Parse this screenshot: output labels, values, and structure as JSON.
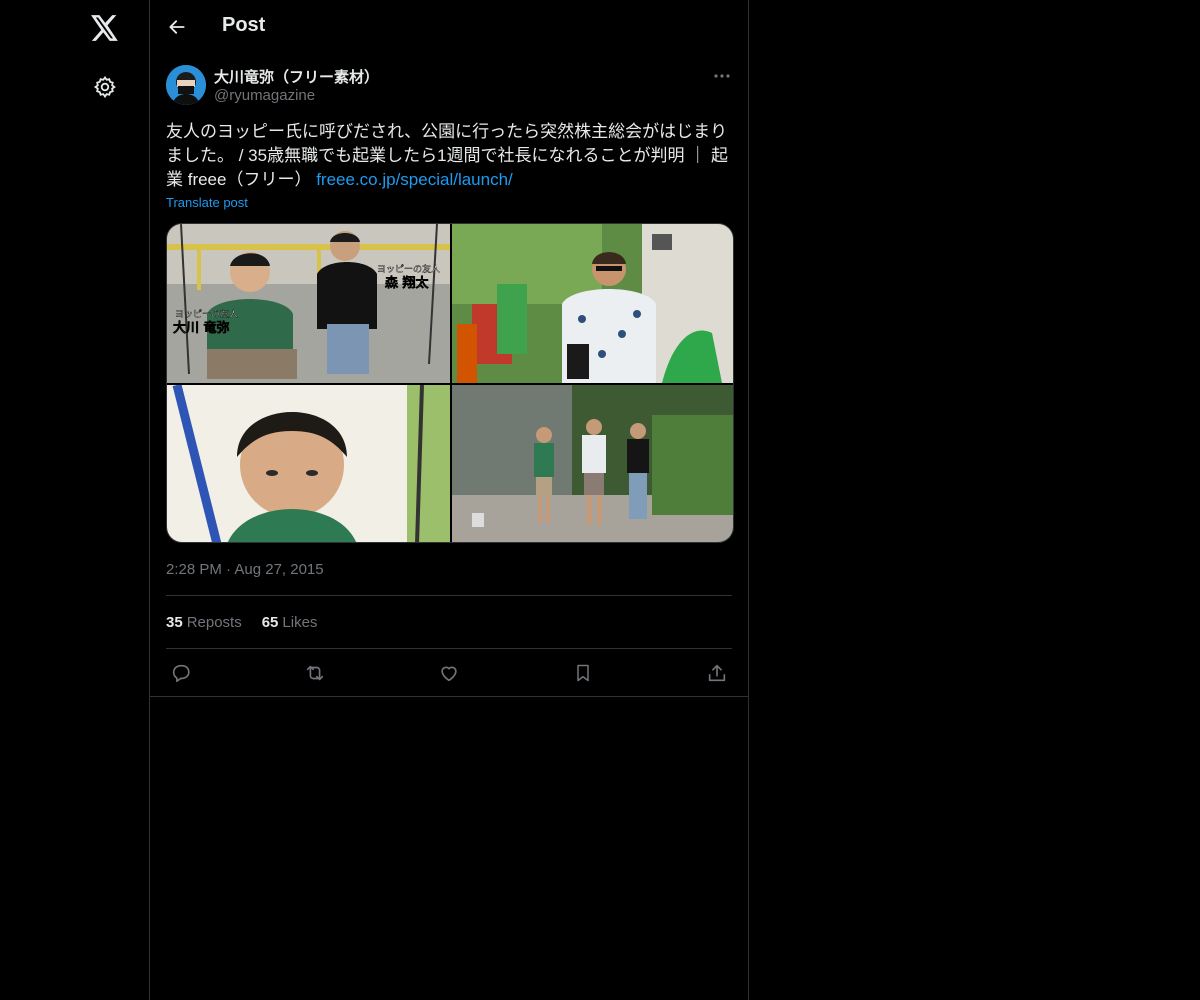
{
  "nav": {
    "logo_icon": "x-logo-icon",
    "settings_icon": "gear-icon"
  },
  "header": {
    "title": "Post",
    "back_icon": "back-arrow-icon"
  },
  "post": {
    "author_name": "大川竜弥（フリー素材）",
    "author_handle": "@ryumagazine",
    "text": "友人のヨッピー氏に呼びだされ、公園に行ったら突然株主総会がはじまりました。 / 35歳無職でも起業したら1週間で社長になれることが判明 ｜ 起業 freee（フリー） ",
    "link_text": "freee.co.jp/special/launch/",
    "translate_label": "Translate post",
    "captions": {
      "img1_a_small": "ヨッピーの友人",
      "img1_a_big": "大川 竜弥",
      "img1_b_small": "ヨッピーの友人",
      "img1_b_big": "森 翔太"
    },
    "timestamp": "2:28 PM · Aug 27, 2015",
    "reposts_count": "35",
    "reposts_label": "Reposts",
    "likes_count": "65",
    "likes_label": "Likes"
  },
  "colors": {
    "background": "#000000",
    "text": "#e7e9ea",
    "muted": "#71767b",
    "accent": "#1d9bf0",
    "border": "#2f3336"
  }
}
